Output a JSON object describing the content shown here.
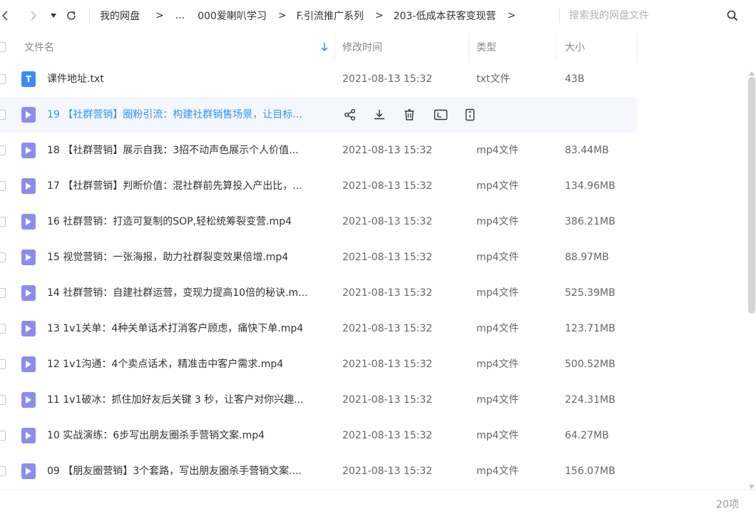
{
  "toolbar": {
    "breadcrumbs": [
      "我的网盘",
      "...",
      "000爱喇叭学习",
      "F.引流推广系列",
      "203-低成本获客变现营"
    ],
    "separator": ">",
    "search_placeholder": "搜索我的网盘文件"
  },
  "columns": {
    "name": "文件名",
    "modified": "修改时间",
    "type": "类型",
    "size": "大小"
  },
  "files": [
    {
      "icon": "txt-file-icon",
      "letter": "T",
      "name": "课件地址.txt",
      "modified": "2021-08-13 15:32",
      "type": "txt文件",
      "size": "43B"
    },
    {
      "icon": "video-file-icon",
      "name": "19 【社群营销】圈粉引流：构建社群销售场景，让目标...",
      "modified": "",
      "type": "",
      "size": "",
      "hovered": true
    },
    {
      "icon": "video-file-icon",
      "name": "18 【社群营销】展示自我：3招不动声色展示个人价值...",
      "modified": "2021-08-13 15:32",
      "type": "mp4文件",
      "size": "83.44MB"
    },
    {
      "icon": "video-file-icon",
      "name": "17 【社群营销】判断价值：混社群前先算投入产出比，...",
      "modified": "2021-08-13 15:32",
      "type": "mp4文件",
      "size": "134.96MB"
    },
    {
      "icon": "video-file-icon",
      "name": "16 社群营销：打造可复制的SOP,轻松统筹裂变营.mp4",
      "modified": "2021-08-13 15:32",
      "type": "mp4文件",
      "size": "386.21MB"
    },
    {
      "icon": "video-file-icon",
      "name": "15 视觉营销：一张海报，助力社群裂变效果倍增.mp4",
      "modified": "2021-08-13 15:32",
      "type": "mp4文件",
      "size": "88.97MB"
    },
    {
      "icon": "video-file-icon",
      "name": "14 社群营销：自建社群运营，变现力提高10倍的秘诀.m...",
      "modified": "2021-08-13 15:32",
      "type": "mp4文件",
      "size": "525.39MB"
    },
    {
      "icon": "video-file-icon",
      "name": "13 1v1关单：4种关单话术打消客户顾虑，痛快下单.mp4",
      "modified": "2021-08-13 15:32",
      "type": "mp4文件",
      "size": "123.71MB"
    },
    {
      "icon": "video-file-icon",
      "name": "12 1v1沟通：4个卖点话术，精准击中客户需求.mp4",
      "modified": "2021-08-13 15:32",
      "type": "mp4文件",
      "size": "500.52MB"
    },
    {
      "icon": "video-file-icon",
      "name": "11 1v1破冰：抓住加好友后关键 3 秒，让客户对你兴趣...",
      "modified": "2021-08-13 15:32",
      "type": "mp4文件",
      "size": "224.31MB"
    },
    {
      "icon": "video-file-icon",
      "name": "10 实战演练：6步写出朋友圈杀手营销文案.mp4",
      "modified": "2021-08-13 15:32",
      "type": "mp4文件",
      "size": "64.27MB"
    },
    {
      "icon": "video-file-icon",
      "name": "09 【朋友圈营销】3个套路，写出朋友圈杀手营销文案....",
      "modified": "2021-08-13 15:32",
      "type": "mp4文件",
      "size": "156.07MB"
    }
  ],
  "row_actions": [
    "share-icon",
    "download-icon",
    "delete-icon",
    "rename-icon",
    "more-icon"
  ],
  "footer": {
    "count": "20项"
  },
  "colors": {
    "accent": "#2e94fa",
    "hover_row": "#f4f7fd",
    "txt_icon": "#3b8cf5",
    "video_icon": "#8c8cf0"
  }
}
